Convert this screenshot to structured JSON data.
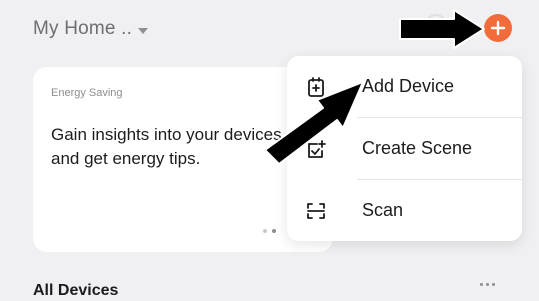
{
  "header": {
    "home_name": "My Home ..",
    "add_button_icon": "plus-icon",
    "add_button_color": "#f26b3a"
  },
  "energy_card": {
    "eyebrow": "Energy Saving",
    "title": "Gain insights into your devices and get energy tips.",
    "pagination": {
      "pages": 2,
      "active": 1
    }
  },
  "menu": {
    "items": [
      {
        "label": "Add Device",
        "icon": "device-add-icon"
      },
      {
        "label": "Create Scene",
        "icon": "scene-add-icon"
      },
      {
        "label": "Scan",
        "icon": "scan-icon"
      }
    ]
  },
  "devices_section": {
    "title": "All Devices",
    "more_icon": "more-dots-icon"
  }
}
